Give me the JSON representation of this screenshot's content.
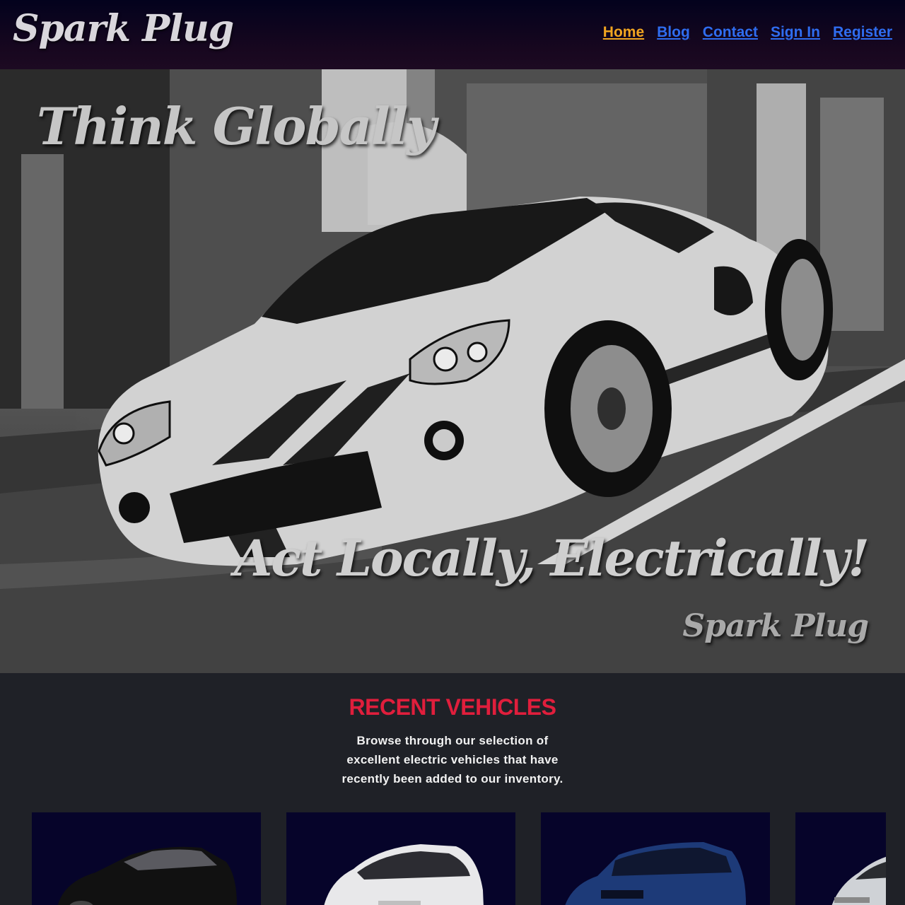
{
  "header": {
    "brand": "Spark Plug",
    "nav": [
      {
        "label": "Home",
        "active": true
      },
      {
        "label": "Blog",
        "active": false
      },
      {
        "label": "Contact",
        "active": false
      },
      {
        "label": "Sign In",
        "active": false
      },
      {
        "label": "Register",
        "active": false
      }
    ]
  },
  "hero": {
    "headline_top": "Think Globally",
    "headline_bottom": "Act Locally, Electrically!",
    "signature": "Spark Plug",
    "image": "ford-gt-black-and-white-photo"
  },
  "recent": {
    "title": "RECENT VEHICLES",
    "description": "Browse through our selection of excellent electric vehicles that have recently been added to our inventory.",
    "cards": [
      {
        "image": "black-sedan",
        "color": "#111111"
      },
      {
        "image": "white-hatchback",
        "color": "#e8e8ea"
      },
      {
        "image": "blue-crossover",
        "color": "#1d3a78"
      },
      {
        "image": "silver-suv",
        "color": "#cfd2d6"
      }
    ]
  },
  "colors": {
    "nav_link": "#2f6df0",
    "nav_active": "#f1a520",
    "section_title": "#e01e3c",
    "header_bg": "#03021d",
    "card_bg": "#06042a",
    "page_bg": "#1f2127"
  }
}
